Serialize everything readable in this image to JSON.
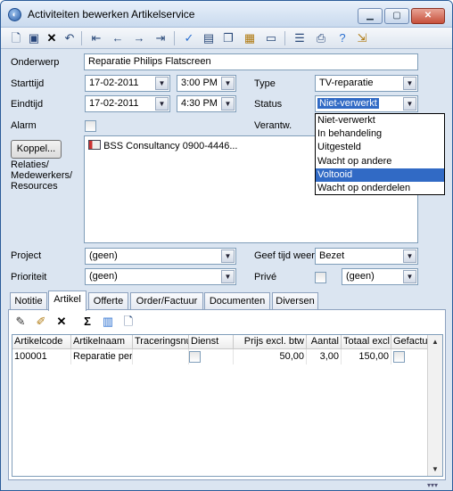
{
  "window": {
    "title": "Activiteiten bewerken Artikelservice",
    "minimize": "▁",
    "maximize": "▢",
    "close": "✕"
  },
  "toolbar": {
    "icons": [
      "new-icon",
      "save-icon",
      "delete-icon",
      "undo-icon",
      "first-icon",
      "prev-icon",
      "next-icon",
      "last-icon",
      "check-icon",
      "preview-icon",
      "copy-icon",
      "paste-icon",
      "print-icon",
      "properties-icon",
      "printer-icon",
      "help-icon",
      "exit-icon"
    ]
  },
  "form": {
    "onderwerp_label": "Onderwerp",
    "onderwerp_value": "Reparatie Philips Flatscreen",
    "starttijd_label": "Starttijd",
    "start_date": "17-02-2011",
    "start_time": "3:00 PM",
    "eindtijd_label": "Eindtijd",
    "end_date": "17-02-2011",
    "end_time": "4:30 PM",
    "type_label": "Type",
    "type_value": "TV-reparatie",
    "status_label": "Status",
    "status_value": "Niet-verwerkt",
    "alarm_label": "Alarm",
    "verantw_label": "Verantw.",
    "koppel_button": "Koppel...",
    "relaties_label": "Relaties/ Medewerkers/ Resources",
    "relation_item": "BSS Consultancy 0900-4446...",
    "project_label": "Project",
    "project_value": "(geen)",
    "geef_tijd_label": "Geef tijd weer",
    "geef_tijd_value": "Bezet",
    "prioriteit_label": "Prioriteit",
    "prioriteit_value": "(geen)",
    "prive_label": "Privé",
    "prive_value": "(geen)"
  },
  "status_dropdown": {
    "options": [
      "Niet-verwerkt",
      "In behandeling",
      "Uitgesteld",
      "Wacht op andere",
      "Voltooid",
      "Wacht op onderdelen"
    ],
    "highlighted": "Voltooid"
  },
  "tabs": [
    "Notitie",
    "Artikel",
    "Offerte",
    "Order/Factuur",
    "Documenten",
    "Diversen"
  ],
  "active_tab": "Artikel",
  "grid": {
    "columns": [
      "Artikelcode",
      "Artikelnaam",
      "Traceringsnu",
      "Dienst",
      "Prijs excl. btw",
      "Aantal",
      "Totaal excl.",
      "Gefactu"
    ],
    "rows": [
      {
        "artikelcode": "100001",
        "artikelnaam": "Reparatie per",
        "tracering": "",
        "prijs": "50,00",
        "aantal": "3,00",
        "totaal": "150,00"
      }
    ]
  }
}
